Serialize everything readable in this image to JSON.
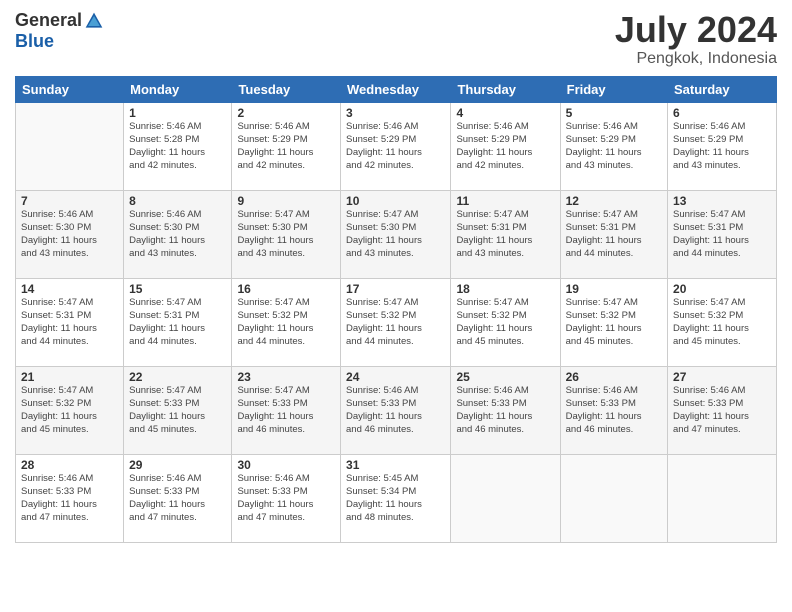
{
  "header": {
    "logo_general": "General",
    "logo_blue": "Blue",
    "month_title": "July 2024",
    "subtitle": "Pengkok, Indonesia"
  },
  "calendar": {
    "days_of_week": [
      "Sunday",
      "Monday",
      "Tuesday",
      "Wednesday",
      "Thursday",
      "Friday",
      "Saturday"
    ],
    "weeks": [
      [
        {
          "day": "",
          "info": ""
        },
        {
          "day": "1",
          "info": "Sunrise: 5:46 AM\nSunset: 5:28 PM\nDaylight: 11 hours\nand 42 minutes."
        },
        {
          "day": "2",
          "info": "Sunrise: 5:46 AM\nSunset: 5:29 PM\nDaylight: 11 hours\nand 42 minutes."
        },
        {
          "day": "3",
          "info": "Sunrise: 5:46 AM\nSunset: 5:29 PM\nDaylight: 11 hours\nand 42 minutes."
        },
        {
          "day": "4",
          "info": "Sunrise: 5:46 AM\nSunset: 5:29 PM\nDaylight: 11 hours\nand 42 minutes."
        },
        {
          "day": "5",
          "info": "Sunrise: 5:46 AM\nSunset: 5:29 PM\nDaylight: 11 hours\nand 43 minutes."
        },
        {
          "day": "6",
          "info": "Sunrise: 5:46 AM\nSunset: 5:29 PM\nDaylight: 11 hours\nand 43 minutes."
        }
      ],
      [
        {
          "day": "7",
          "info": "Sunrise: 5:46 AM\nSunset: 5:30 PM\nDaylight: 11 hours\nand 43 minutes."
        },
        {
          "day": "8",
          "info": "Sunrise: 5:46 AM\nSunset: 5:30 PM\nDaylight: 11 hours\nand 43 minutes."
        },
        {
          "day": "9",
          "info": "Sunrise: 5:47 AM\nSunset: 5:30 PM\nDaylight: 11 hours\nand 43 minutes."
        },
        {
          "day": "10",
          "info": "Sunrise: 5:47 AM\nSunset: 5:30 PM\nDaylight: 11 hours\nand 43 minutes."
        },
        {
          "day": "11",
          "info": "Sunrise: 5:47 AM\nSunset: 5:31 PM\nDaylight: 11 hours\nand 43 minutes."
        },
        {
          "day": "12",
          "info": "Sunrise: 5:47 AM\nSunset: 5:31 PM\nDaylight: 11 hours\nand 44 minutes."
        },
        {
          "day": "13",
          "info": "Sunrise: 5:47 AM\nSunset: 5:31 PM\nDaylight: 11 hours\nand 44 minutes."
        }
      ],
      [
        {
          "day": "14",
          "info": "Sunrise: 5:47 AM\nSunset: 5:31 PM\nDaylight: 11 hours\nand 44 minutes."
        },
        {
          "day": "15",
          "info": "Sunrise: 5:47 AM\nSunset: 5:31 PM\nDaylight: 11 hours\nand 44 minutes."
        },
        {
          "day": "16",
          "info": "Sunrise: 5:47 AM\nSunset: 5:32 PM\nDaylight: 11 hours\nand 44 minutes."
        },
        {
          "day": "17",
          "info": "Sunrise: 5:47 AM\nSunset: 5:32 PM\nDaylight: 11 hours\nand 44 minutes."
        },
        {
          "day": "18",
          "info": "Sunrise: 5:47 AM\nSunset: 5:32 PM\nDaylight: 11 hours\nand 45 minutes."
        },
        {
          "day": "19",
          "info": "Sunrise: 5:47 AM\nSunset: 5:32 PM\nDaylight: 11 hours\nand 45 minutes."
        },
        {
          "day": "20",
          "info": "Sunrise: 5:47 AM\nSunset: 5:32 PM\nDaylight: 11 hours\nand 45 minutes."
        }
      ],
      [
        {
          "day": "21",
          "info": "Sunrise: 5:47 AM\nSunset: 5:32 PM\nDaylight: 11 hours\nand 45 minutes."
        },
        {
          "day": "22",
          "info": "Sunrise: 5:47 AM\nSunset: 5:33 PM\nDaylight: 11 hours\nand 45 minutes."
        },
        {
          "day": "23",
          "info": "Sunrise: 5:47 AM\nSunset: 5:33 PM\nDaylight: 11 hours\nand 46 minutes."
        },
        {
          "day": "24",
          "info": "Sunrise: 5:46 AM\nSunset: 5:33 PM\nDaylight: 11 hours\nand 46 minutes."
        },
        {
          "day": "25",
          "info": "Sunrise: 5:46 AM\nSunset: 5:33 PM\nDaylight: 11 hours\nand 46 minutes."
        },
        {
          "day": "26",
          "info": "Sunrise: 5:46 AM\nSunset: 5:33 PM\nDaylight: 11 hours\nand 46 minutes."
        },
        {
          "day": "27",
          "info": "Sunrise: 5:46 AM\nSunset: 5:33 PM\nDaylight: 11 hours\nand 47 minutes."
        }
      ],
      [
        {
          "day": "28",
          "info": "Sunrise: 5:46 AM\nSunset: 5:33 PM\nDaylight: 11 hours\nand 47 minutes."
        },
        {
          "day": "29",
          "info": "Sunrise: 5:46 AM\nSunset: 5:33 PM\nDaylight: 11 hours\nand 47 minutes."
        },
        {
          "day": "30",
          "info": "Sunrise: 5:46 AM\nSunset: 5:33 PM\nDaylight: 11 hours\nand 47 minutes."
        },
        {
          "day": "31",
          "info": "Sunrise: 5:45 AM\nSunset: 5:34 PM\nDaylight: 11 hours\nand 48 minutes."
        },
        {
          "day": "",
          "info": ""
        },
        {
          "day": "",
          "info": ""
        },
        {
          "day": "",
          "info": ""
        }
      ]
    ]
  }
}
